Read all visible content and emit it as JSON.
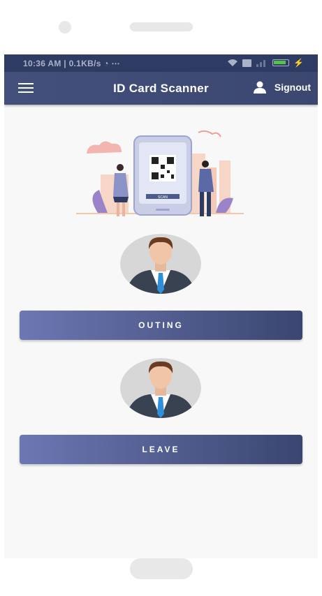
{
  "status_bar": {
    "time": "10:36 AM | 0.1KB/s",
    "extra": "⋯"
  },
  "app_bar": {
    "title": "ID Card Scanner",
    "signout_label": "Signout"
  },
  "illustration": {
    "scan_label": "SCAN"
  },
  "actions": [
    {
      "label": "OUTING"
    },
    {
      "label": "LEAVE"
    }
  ],
  "colors": {
    "app_bar": "#3f4c76",
    "button_start": "#6d77b3",
    "button_end": "#3a4670",
    "background": "#f8f8f8"
  },
  "icons": {
    "menu": "hamburger-icon",
    "signout": "person-icon",
    "avatar": "businessman-avatar"
  }
}
